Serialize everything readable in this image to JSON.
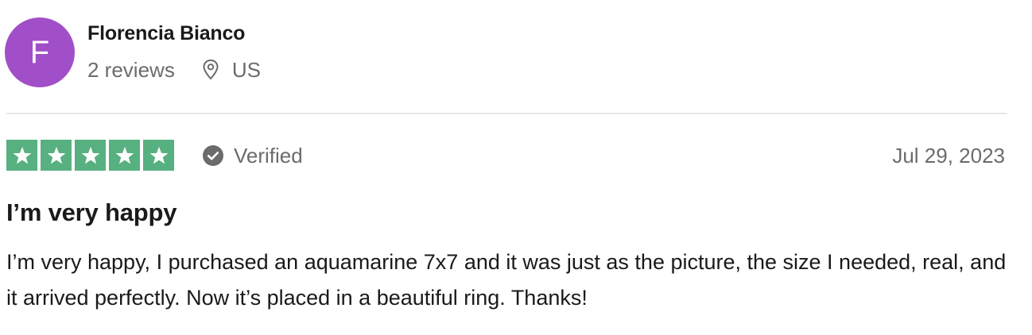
{
  "author": {
    "initial": "F",
    "name": "Florencia Bianco",
    "reviews_count": "2 reviews",
    "country": "US",
    "avatar_color": "#a14fc8"
  },
  "rating": {
    "stars": 5,
    "max_stars": 5,
    "star_color": "#57b07f",
    "verified_label": "Verified",
    "date": "Jul 29, 2023"
  },
  "review": {
    "title": "I’m very happy",
    "body": "I’m very happy, I purchased an aquamarine 7x7 and it was just as the picture, the size I needed, real, and it arrived perfectly. Now it’s placed in a beautiful ring. Thanks!"
  },
  "icons": {
    "location": "location-pin-icon",
    "verified": "check-circle-icon",
    "star": "star-icon"
  }
}
